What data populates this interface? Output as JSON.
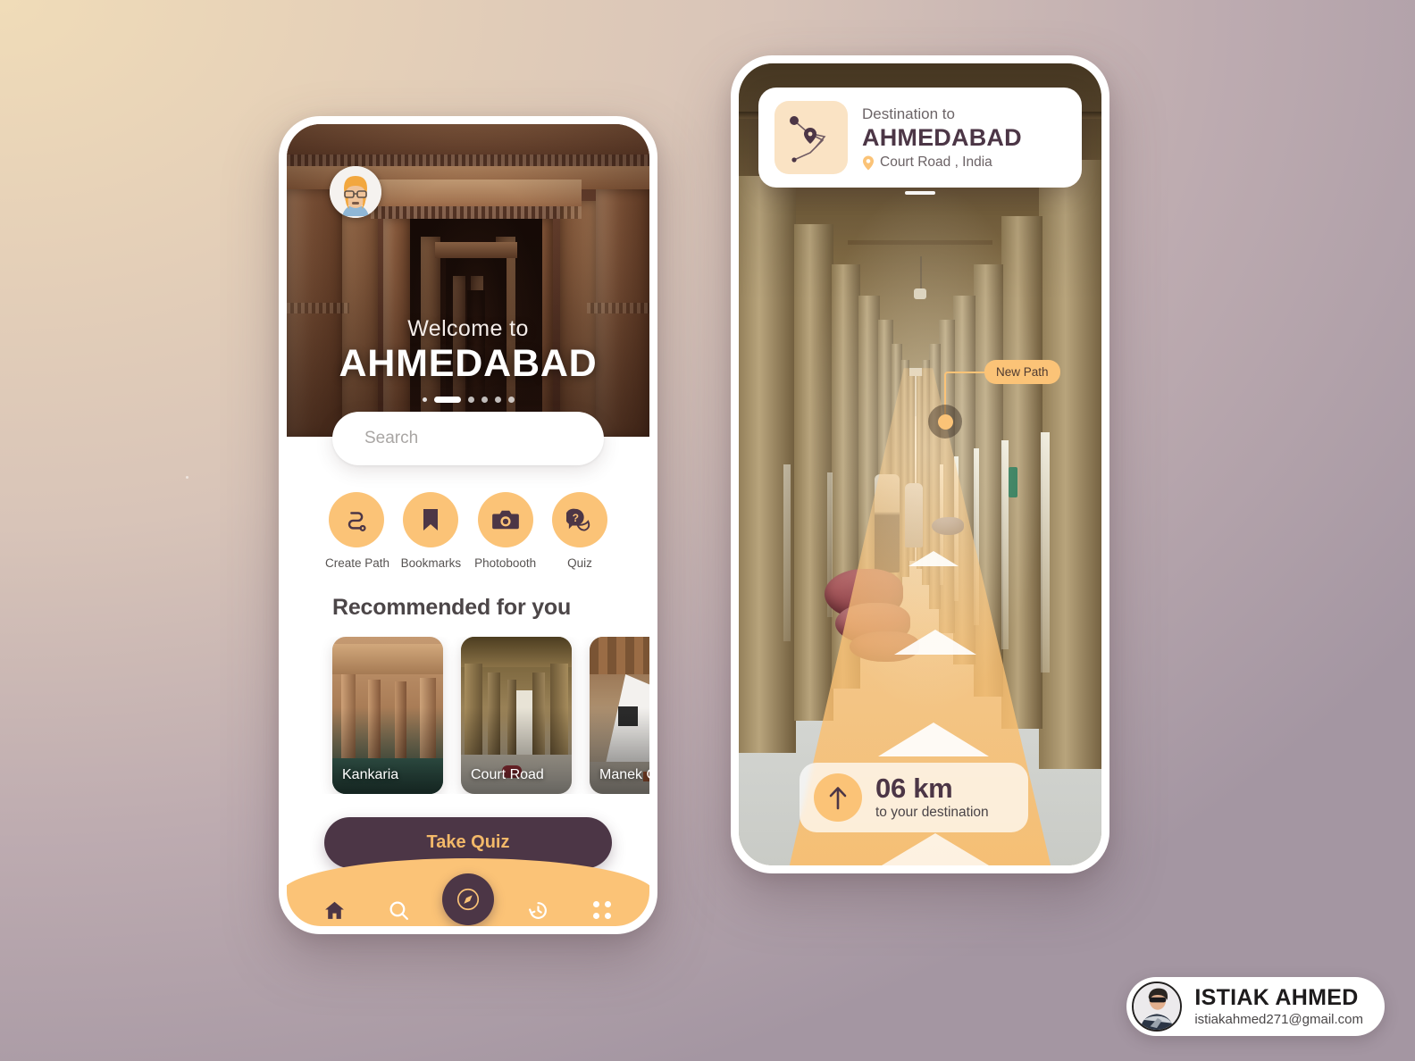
{
  "colors": {
    "accent_yellow": "#fbc377",
    "accent_yellow_soft": "#fae3c4",
    "dark_plum": "#4c3646",
    "quiz_text": "#f3b969",
    "card_white": "#ffffff",
    "bg_beige": "#e6d0b8",
    "bg_mauve": "#a496a2"
  },
  "home_screen": {
    "avatar": {
      "icon": "user-avatar"
    },
    "hero": {
      "welcome_label": "Welcome to",
      "city": "AHMEDABAD",
      "carousel": {
        "total": 6,
        "active_index": 1
      }
    },
    "search": {
      "placeholder": "Search",
      "value": "",
      "icon": "search-icon"
    },
    "quick_actions": [
      {
        "label": "Create Path",
        "icon": "route-path-icon"
      },
      {
        "label": "Bookmarks",
        "icon": "bookmark-icon"
      },
      {
        "label": "Photobooth",
        "icon": "camera-icon"
      },
      {
        "label": "Quiz",
        "icon": "question-chat-icon"
      }
    ],
    "recommended": {
      "title": "Recommended for you",
      "cards": [
        {
          "label": "Kankaria"
        },
        {
          "label": "Court Road"
        },
        {
          "label": "Manek Ch"
        }
      ]
    },
    "primary_button": {
      "label": "Take Quiz"
    },
    "bottom_nav": [
      {
        "icon": "home-icon",
        "name": "home",
        "active": true
      },
      {
        "icon": "search-icon",
        "name": "search",
        "active": false
      },
      {
        "icon": "compass-icon",
        "name": "explore",
        "active": true
      },
      {
        "icon": "history-clock-icon",
        "name": "history",
        "active": false
      },
      {
        "icon": "grid-more-icon",
        "name": "more",
        "active": false
      }
    ]
  },
  "nav_screen": {
    "destination_card": {
      "eyebrow": "Destination to",
      "title": "AHMEDABAD",
      "location": "Court Road , India",
      "location_icon": "map-pin-icon",
      "thumb_icon": "route-map-icon"
    },
    "new_path_badge": {
      "label": "New Path"
    },
    "distance_card": {
      "icon": "arrow-up-icon",
      "distance": "06 km",
      "subtitle": "to your destination"
    }
  },
  "credit": {
    "name": "ISTIAK AHMED",
    "email": "istiakahmed271@gmail.com",
    "avatar": "designer-avatar"
  }
}
